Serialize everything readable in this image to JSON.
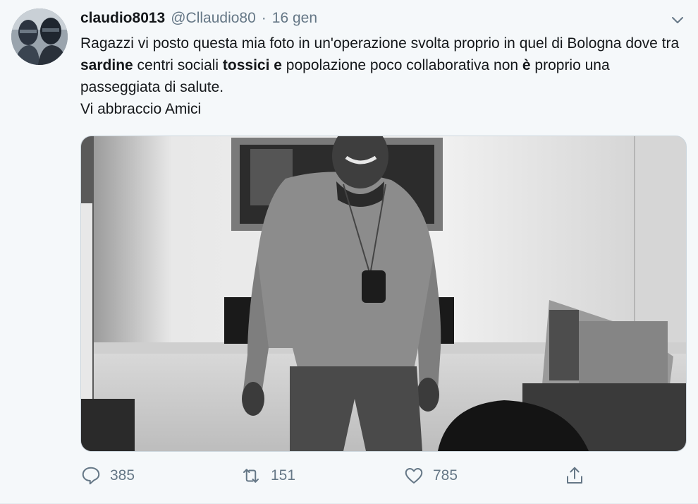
{
  "tweet": {
    "display_name": "claudio8013",
    "handle": "@Cllaudio80",
    "separator": "·",
    "time": "16 gen",
    "text": {
      "p1": "Ragazzi vi posto questa mia foto in un'operazione svolta proprio in quel di Bologna dove tra ",
      "bold1": "sardine",
      "p2": " centri sociali ",
      "bold2": "tossici e",
      "p3": " popolazione poco collaborativa non ",
      "bold3": "è",
      "p4": " proprio una passeggiata di salute.",
      "line2": "Vi abbraccio Amici"
    }
  },
  "actions": {
    "reply_count": "385",
    "retweet_count": "151",
    "like_count": "785"
  },
  "icons": {
    "reply": "reply-icon",
    "retweet": "retweet-icon",
    "like": "heart-icon",
    "share": "share-icon",
    "more": "chevron-down-icon"
  },
  "colors": {
    "text": "#14171a",
    "secondary": "#657786",
    "background": "#f5f8fa"
  }
}
